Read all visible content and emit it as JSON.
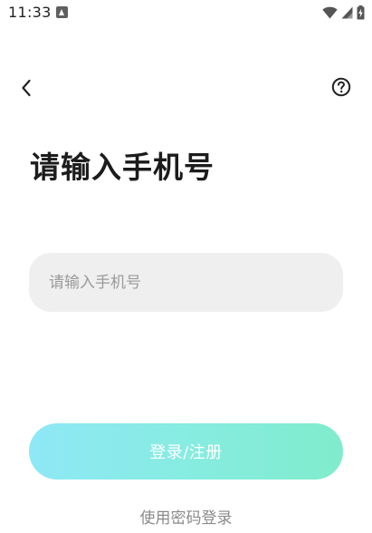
{
  "status_bar": {
    "time": "11:33",
    "notification_icon": "a-app-icon",
    "wifi_icon": "wifi-icon",
    "signal_icon": "signal-icon",
    "battery_icon": "battery-charging-icon"
  },
  "toolbar": {
    "back_icon": "chevron-left-icon",
    "help_icon": "help-circle-icon"
  },
  "page": {
    "title": "请输入手机号"
  },
  "phone_input": {
    "placeholder": "请输入手机号",
    "value": ""
  },
  "login_button": {
    "label": "登录/注册",
    "enabled": false,
    "gradient_start": "#8fe8f6",
    "gradient_end": "#80eccc"
  },
  "password_login": {
    "label": "使用密码登录"
  }
}
